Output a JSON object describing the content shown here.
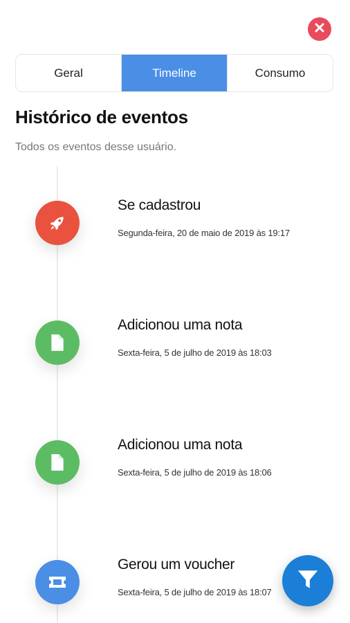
{
  "header": {
    "close_icon": "close-icon",
    "close_color": "#e84b5c"
  },
  "tabs": [
    {
      "label": "Geral",
      "active": false
    },
    {
      "label": "Timeline",
      "active": true
    },
    {
      "label": "Consumo",
      "active": false
    }
  ],
  "accent_color": "#4a8ee6",
  "main": {
    "title": "Histórico de eventos",
    "subtitle": "Todos os eventos desse usuário."
  },
  "events": [
    {
      "title": "Se cadastrou",
      "date": "Segunda-feira, 20 de maio de 2019 às 19:17",
      "icon": "rocket-icon",
      "color": "#e8523f"
    },
    {
      "title": "Adicionou uma nota",
      "date": "Sexta-feira, 5 de julho de 2019 às 18:03",
      "icon": "document-icon",
      "color": "#5cbc64"
    },
    {
      "title": "Adicionou uma nota",
      "date": "Sexta-feira, 5 de julho de 2019 às 18:06",
      "icon": "document-icon",
      "color": "#5cbc64"
    },
    {
      "title": "Gerou um voucher",
      "date": "Sexta-feira, 5 de julho de 2019 às 18:07",
      "icon": "ticket-icon",
      "color": "#4a8ee6"
    }
  ],
  "filter_button": {
    "icon": "filter-icon",
    "color": "#1b7fd8"
  }
}
